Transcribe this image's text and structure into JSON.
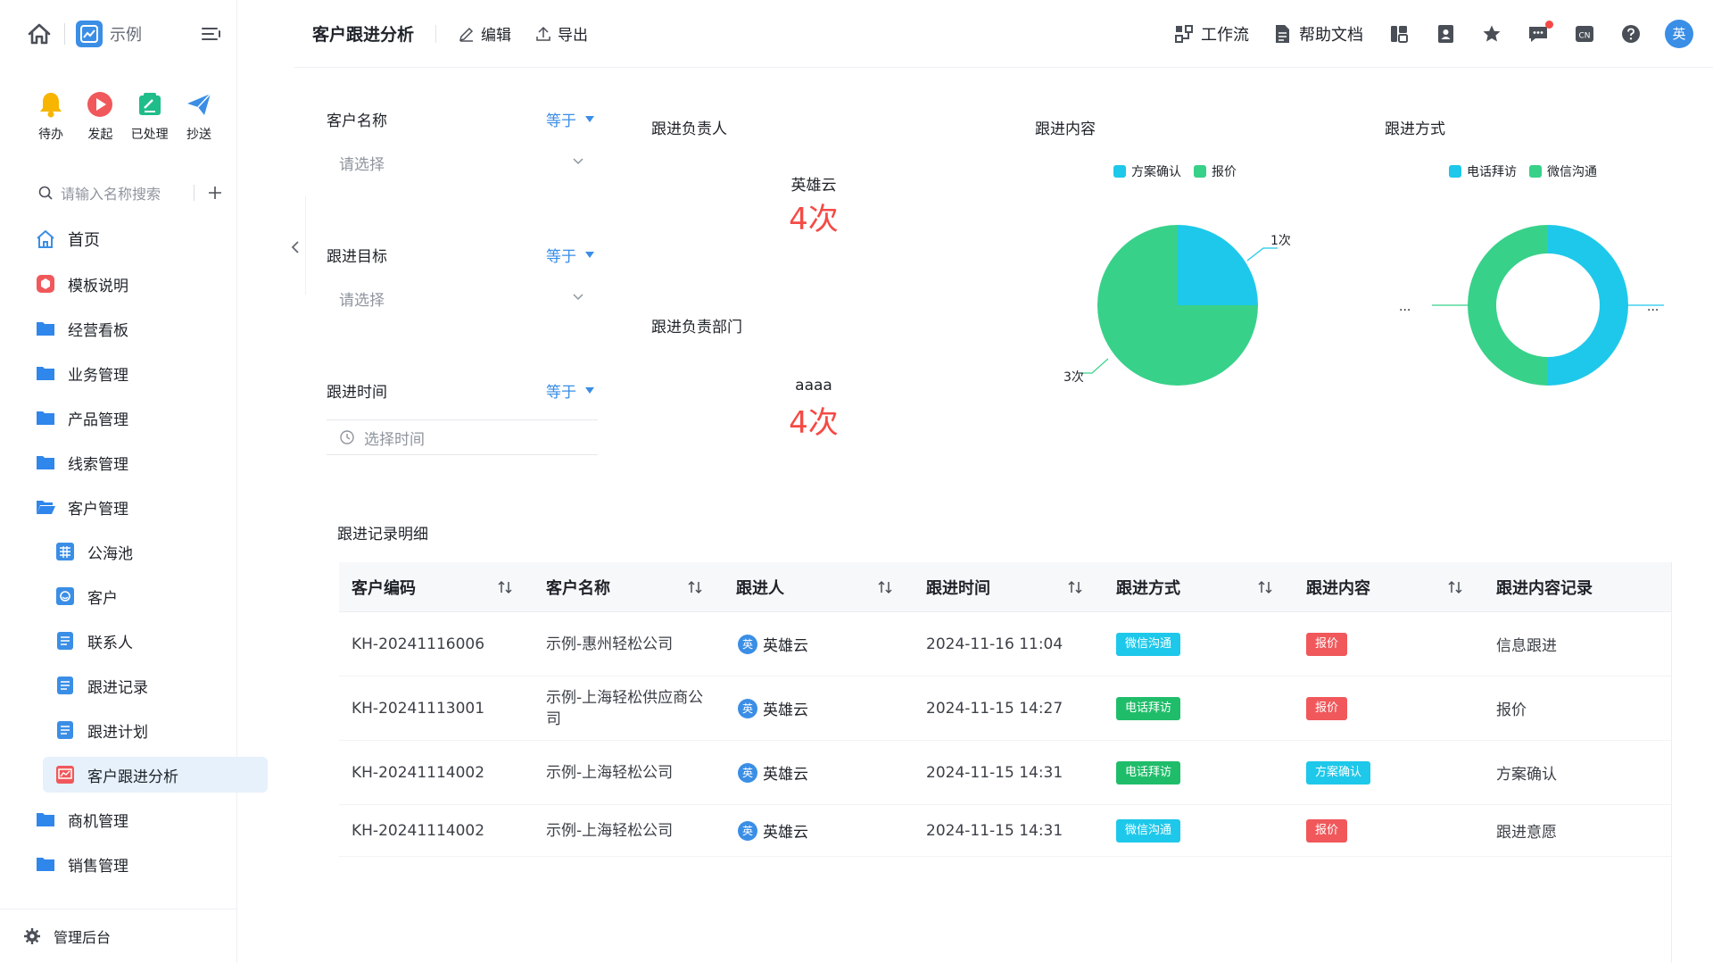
{
  "app": {
    "name": "示例"
  },
  "quick_actions": [
    {
      "label": "待办",
      "icon": "bell-icon",
      "color": "#f7b500"
    },
    {
      "label": "发起",
      "icon": "play-icon",
      "color": "#f0585b"
    },
    {
      "label": "已处理",
      "icon": "check-doc-icon",
      "color": "#1fbd8a"
    },
    {
      "label": "抄送",
      "icon": "send-icon",
      "color": "#3a8ee6"
    }
  ],
  "search": {
    "placeholder": "请输入名称搜索"
  },
  "nav": {
    "home": "首页",
    "template": "模板说明",
    "folders": [
      "经营看板",
      "业务管理",
      "产品管理",
      "线索管理",
      "客户管理"
    ],
    "customer_children": [
      "公海池",
      "客户",
      "联系人",
      "跟进记录",
      "跟进计划",
      "客户跟进分析"
    ],
    "folders_after": [
      "商机管理",
      "销售管理"
    ],
    "admin": "管理后台"
  },
  "header": {
    "title": "客户跟进分析",
    "edit": "编辑",
    "export": "导出",
    "workflow": "工作流",
    "help": "帮助文档",
    "avatar": "英"
  },
  "filters": [
    {
      "label": "客户名称",
      "operator": "等于",
      "placeholder": "请选择"
    },
    {
      "label": "跟进目标",
      "operator": "等于",
      "placeholder": "请选择"
    },
    {
      "label": "跟进时间",
      "operator": "等于",
      "placeholder": "选择时间"
    }
  ],
  "stats": {
    "owner": {
      "title": "跟进负责人",
      "name": "英雄云",
      "value": "4次"
    },
    "dept": {
      "title": "跟进负责部门",
      "name": "aaaa",
      "value": "4次"
    }
  },
  "charts": {
    "content": {
      "title": "跟进内容",
      "legend": [
        {
          "name": "方案确认",
          "color": "#1ec8ea"
        },
        {
          "name": "报价",
          "color": "#38d18a"
        }
      ],
      "labels": {
        "small": "1次",
        "large": "3次"
      }
    },
    "method": {
      "title": "跟进方式",
      "legend": [
        {
          "name": "电话拜访",
          "color": "#1ec8ea"
        },
        {
          "name": "微信沟通",
          "color": "#38d18a"
        }
      ],
      "labels": {
        "left": "...",
        "right": "..."
      }
    }
  },
  "chart_data": [
    {
      "type": "pie",
      "title": "跟进内容",
      "categories": [
        "方案确认",
        "报价"
      ],
      "values": [
        1,
        3
      ],
      "labels": [
        "1次",
        "3次"
      ]
    },
    {
      "type": "pie",
      "title": "跟进方式",
      "categories": [
        "电话拜访",
        "微信沟通"
      ],
      "values": [
        2,
        2
      ],
      "donut": true,
      "labels": [
        "...",
        "..."
      ]
    }
  ],
  "table": {
    "title": "跟进记录明细",
    "columns": [
      "客户编码",
      "客户名称",
      "跟进人",
      "跟进时间",
      "跟进方式",
      "跟进内容",
      "跟进内容记录"
    ],
    "rows": [
      {
        "code": "KH-20241116006",
        "name": "示例-惠州轻松公司",
        "user": "英雄云",
        "user_initial": "英",
        "time": "2024-11-16 11:04",
        "method": "微信沟通",
        "method_color": "#1ec8ea",
        "content": "报价",
        "content_color": "#f0585b",
        "record": "信息跟进"
      },
      {
        "code": "KH-20241113001",
        "name": "示例-上海轻松供应商公司",
        "user": "英雄云",
        "user_initial": "英",
        "time": "2024-11-15 14:27",
        "method": "电话拜访",
        "method_color": "#1fbd6a",
        "content": "报价",
        "content_color": "#f0585b",
        "record": "报价"
      },
      {
        "code": "KH-20241114002",
        "name": "示例-上海轻松公司",
        "user": "英雄云",
        "user_initial": "英",
        "time": "2024-11-15 14:31",
        "method": "电话拜访",
        "method_color": "#1fbd6a",
        "content": "方案确认",
        "content_color": "#1ec8ea",
        "record": "方案确认"
      },
      {
        "code": "KH-20241114002",
        "name": "示例-上海轻松公司",
        "user": "英雄云",
        "user_initial": "英",
        "time": "2024-11-15 14:31",
        "method": "微信沟通",
        "method_color": "#1ec8ea",
        "content": "报价",
        "content_color": "#f0585b",
        "record": "跟进意愿"
      }
    ]
  }
}
